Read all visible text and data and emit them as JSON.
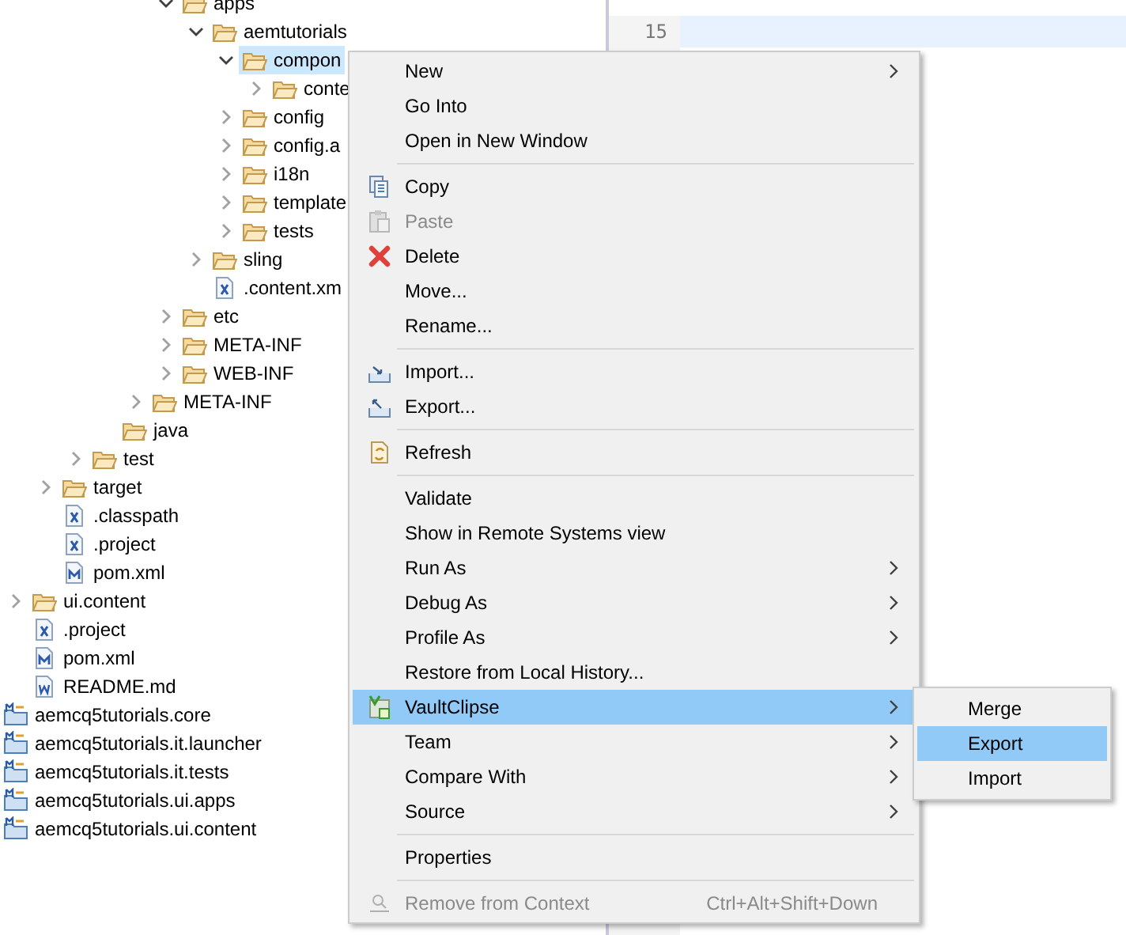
{
  "tree": {
    "items": [
      {
        "children": [
          {
            "children": [
              {
                "children": [
                  {
                    "children": [
                      {
                        "children": [
                          {
                            "label": "apps",
                            "kind": "folder",
                            "expanded": true,
                            "selected": false,
                            "children": [
                              {
                                "label": "aemtutorials",
                                "kind": "folder",
                                "expanded": true,
                                "selected": false,
                                "children": [
                                  {
                                    "label": "compon",
                                    "kind": "folder",
                                    "expanded": true,
                                    "selected": true,
                                    "children": [
                                      {
                                        "label": "conte",
                                        "kind": "folder",
                                        "expanded": false,
                                        "selected": false
                                      }
                                    ]
                                  },
                                  {
                                    "label": "config",
                                    "kind": "folder",
                                    "expanded": false,
                                    "selected": false
                                  },
                                  {
                                    "label": "config.a",
                                    "kind": "folder",
                                    "expanded": false,
                                    "selected": false
                                  },
                                  {
                                    "label": "i18n",
                                    "kind": "folder",
                                    "expanded": false,
                                    "selected": false
                                  },
                                  {
                                    "label": "template",
                                    "kind": "folder",
                                    "expanded": false,
                                    "selected": false
                                  },
                                  {
                                    "label": "tests",
                                    "kind": "folder",
                                    "expanded": false,
                                    "selected": false
                                  }
                                ]
                              },
                              {
                                "label": "sling",
                                "kind": "folder",
                                "expanded": false,
                                "selected": false
                              },
                              {
                                "label": ".content.xm",
                                "kind": "xml",
                                "selected": false
                              }
                            ]
                          },
                          {
                            "label": "etc",
                            "kind": "folder",
                            "expanded": false,
                            "selected": false
                          },
                          {
                            "label": "META-INF",
                            "kind": "folder",
                            "expanded": false,
                            "selected": false
                          },
                          {
                            "label": "WEB-INF",
                            "kind": "folder",
                            "expanded": false,
                            "selected": false
                          }
                        ]
                      },
                      {
                        "label": "META-INF",
                        "kind": "folder",
                        "expanded": false,
                        "selected": false
                      }
                    ]
                  },
                  {
                    "label": "java",
                    "kind": "folder",
                    "selected": false
                  }
                ]
              },
              {
                "label": "test",
                "kind": "folder",
                "expanded": false,
                "selected": false
              }
            ]
          },
          {
            "label": "target",
            "kind": "folder",
            "expanded": false,
            "selected": false
          },
          {
            "label": ".classpath",
            "kind": "xml",
            "selected": false
          },
          {
            "label": ".project",
            "kind": "xml",
            "selected": false
          },
          {
            "label": "pom.xml",
            "kind": "maven",
            "selected": false
          }
        ]
      },
      {
        "label": "ui.content",
        "kind": "folder",
        "expanded": false,
        "selected": false
      },
      {
        "label": ".project",
        "kind": "xml",
        "selected": false
      },
      {
        "label": "pom.xml",
        "kind": "maven",
        "selected": false
      },
      {
        "label": "README.md",
        "kind": "word",
        "selected": false
      }
    ]
  },
  "projects": [
    {
      "label": "aemcq5tutorials.core",
      "selected": false
    },
    {
      "label": "aemcq5tutorials.it.launcher",
      "selected": false
    },
    {
      "label": "aemcq5tutorials.it.tests",
      "selected": false
    },
    {
      "label": "aemcq5tutorials.ui.apps",
      "selected": false
    },
    {
      "label": "aemcq5tutorials.ui.content",
      "selected": false
    }
  ],
  "editor": {
    "lines": [
      {
        "number": "15",
        "current": true
      }
    ]
  },
  "context_menu": {
    "items": [
      {
        "kind": "plain",
        "label": "New",
        "submenu": true,
        "disabled": false,
        "selected": false
      },
      {
        "kind": "plain",
        "label": "Go Into",
        "submenu": false,
        "disabled": false,
        "selected": false
      },
      {
        "kind": "plain",
        "label": "Open in New Window",
        "submenu": false,
        "disabled": false,
        "selected": false
      },
      {
        "kind": "separator"
      },
      {
        "kind": "copy",
        "label": "Copy",
        "submenu": false,
        "disabled": false,
        "selected": false
      },
      {
        "kind": "paste",
        "label": "Paste",
        "submenu": false,
        "disabled": true,
        "selected": false
      },
      {
        "kind": "delete",
        "label": "Delete",
        "submenu": false,
        "disabled": false,
        "selected": false
      },
      {
        "kind": "plain",
        "label": "Move...",
        "submenu": false,
        "disabled": false,
        "selected": false
      },
      {
        "kind": "plain",
        "label": "Rename...",
        "submenu": false,
        "disabled": false,
        "selected": false
      },
      {
        "kind": "separator"
      },
      {
        "kind": "import",
        "label": "Import...",
        "submenu": false,
        "disabled": false,
        "selected": false
      },
      {
        "kind": "export",
        "label": "Export...",
        "submenu": false,
        "disabled": false,
        "selected": false
      },
      {
        "kind": "separator"
      },
      {
        "kind": "refresh",
        "label": "Refresh",
        "submenu": false,
        "disabled": false,
        "selected": false
      },
      {
        "kind": "separator"
      },
      {
        "kind": "plain",
        "label": "Validate",
        "submenu": false,
        "disabled": false,
        "selected": false
      },
      {
        "kind": "plain",
        "label": "Show in Remote Systems view",
        "submenu": false,
        "disabled": false,
        "selected": false
      },
      {
        "kind": "plain",
        "label": "Run As",
        "submenu": true,
        "disabled": false,
        "selected": false
      },
      {
        "kind": "plain",
        "label": "Debug As",
        "submenu": true,
        "disabled": false,
        "selected": false
      },
      {
        "kind": "plain",
        "label": "Profile As",
        "submenu": true,
        "disabled": false,
        "selected": false
      },
      {
        "kind": "plain",
        "label": "Restore from Local History...",
        "submenu": false,
        "disabled": false,
        "selected": false
      },
      {
        "kind": "vault",
        "label": "VaultClipse",
        "submenu": true,
        "disabled": false,
        "selected": true
      },
      {
        "kind": "plain",
        "label": "Team",
        "submenu": true,
        "disabled": false,
        "selected": false
      },
      {
        "kind": "plain",
        "label": "Compare With",
        "submenu": true,
        "disabled": false,
        "selected": false
      },
      {
        "kind": "plain",
        "label": "Source",
        "submenu": true,
        "disabled": false,
        "selected": false
      },
      {
        "kind": "separator"
      },
      {
        "kind": "plain",
        "label": "Properties",
        "submenu": false,
        "disabled": false,
        "selected": false
      },
      {
        "kind": "separator"
      },
      {
        "kind": "context",
        "label": "Remove from Context",
        "shortcut": "Ctrl+Alt+Shift+Down",
        "submenu": false,
        "disabled": true,
        "selected": false
      }
    ]
  },
  "submenu": {
    "items": [
      {
        "label": "Merge",
        "selected": false
      },
      {
        "label": "Export",
        "selected": true
      },
      {
        "label": "Import",
        "selected": false
      }
    ]
  }
}
